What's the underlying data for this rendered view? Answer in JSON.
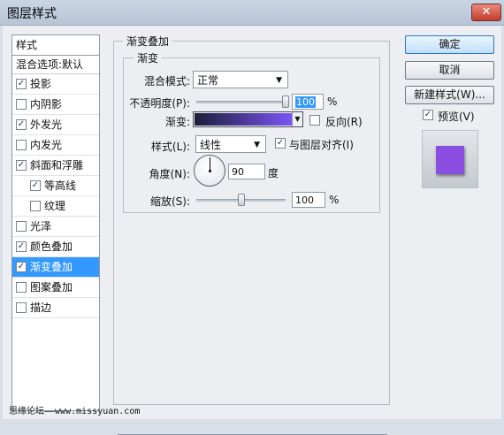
{
  "window": {
    "title": "图层样式",
    "close_glyph": "✕"
  },
  "styles_panel": {
    "header": "样式",
    "blend_options": "混合选项:默认",
    "items": [
      {
        "label": "投影",
        "checked": true,
        "indent": false,
        "selected": false
      },
      {
        "label": "内阴影",
        "checked": false,
        "indent": false,
        "selected": false
      },
      {
        "label": "外发光",
        "checked": true,
        "indent": false,
        "selected": false
      },
      {
        "label": "内发光",
        "checked": false,
        "indent": false,
        "selected": false
      },
      {
        "label": "斜面和浮雕",
        "checked": true,
        "indent": false,
        "selected": false
      },
      {
        "label": "等高线",
        "checked": true,
        "indent": true,
        "selected": false
      },
      {
        "label": "纹理",
        "checked": false,
        "indent": true,
        "selected": false
      },
      {
        "label": "光泽",
        "checked": false,
        "indent": false,
        "selected": false
      },
      {
        "label": "颜色叠加",
        "checked": true,
        "indent": false,
        "selected": false
      },
      {
        "label": "渐变叠加",
        "checked": true,
        "indent": false,
        "selected": true
      },
      {
        "label": "图案叠加",
        "checked": false,
        "indent": false,
        "selected": false
      },
      {
        "label": "描边",
        "checked": false,
        "indent": false,
        "selected": false
      }
    ]
  },
  "gradient_overlay": {
    "group_title": "渐变叠加",
    "sub_title": "渐变",
    "blend_mode_label": "混合模式:",
    "blend_mode_value": "正常",
    "opacity_label": "不透明度(P):",
    "opacity_value": "100",
    "opacity_fraction": 1.0,
    "percent": "%",
    "gradient_label": "渐变:",
    "gradient_colors": [
      "#1d1d3a",
      "#7b55f5"
    ],
    "reverse_label": "反向(R)",
    "reverse_checked": false,
    "style_label": "样式(L):",
    "style_value": "线性",
    "align_label": "与图层对齐(I)",
    "align_checked": true,
    "angle_label": "角度(N):",
    "angle_value": "90",
    "degree_unit": "度",
    "scale_label": "缩放(S):",
    "scale_value": "100",
    "scale_fraction": 0.5
  },
  "buttons": {
    "ok": "确定",
    "cancel": "取消",
    "new_style": "新建样式(W)...",
    "preview_label": "预览(V)",
    "preview_checked": true
  },
  "colors": {
    "accent": "#3399ff",
    "preview": "#8a4fe0",
    "close": "#c94a3a"
  },
  "watermark": "思缘论坛——www.missyuan.com"
}
